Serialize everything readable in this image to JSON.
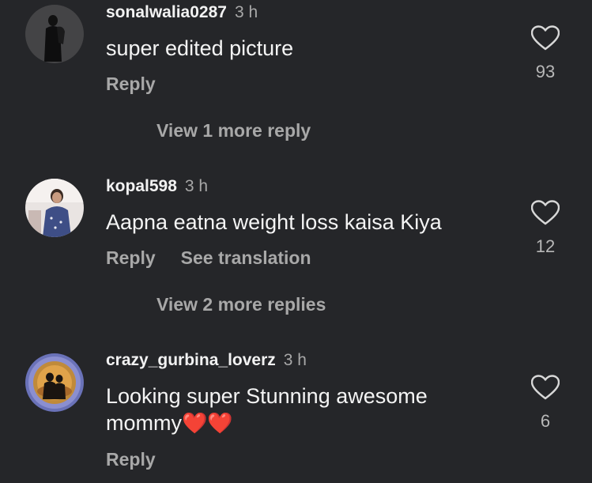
{
  "comments": [
    {
      "username": "sonalwalia0287",
      "time": "3 h",
      "text": "super edited picture",
      "reply_label": "Reply",
      "likes": "93",
      "view_more": "View 1 more reply"
    },
    {
      "username": "kopal598",
      "time": "3 h",
      "text": "Aapna eatna weight loss kaisa Kiya",
      "reply_label": "Reply",
      "translate_label": "See translation",
      "likes": "12",
      "view_more": "View 2 more replies"
    },
    {
      "username": "crazy_gurbina_loverz",
      "time": "3 h",
      "text_line1": "Looking super Stunning awesome",
      "text_line2": "mommy",
      "emoji": "❤️❤️",
      "reply_label": "Reply",
      "likes": "6"
    }
  ]
}
